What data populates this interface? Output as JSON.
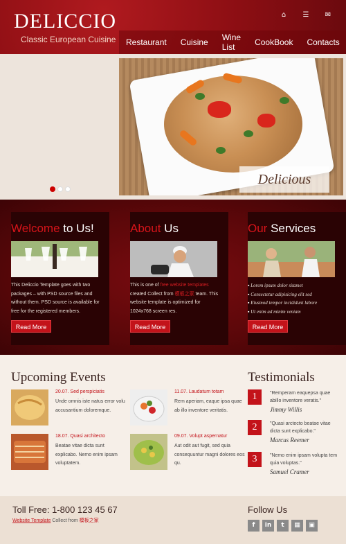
{
  "header": {
    "logo": "DELICCIO",
    "tagline": "Classic European Cuisine",
    "icons": [
      "home-icon",
      "sitemap-icon",
      "mail-icon"
    ],
    "nav": [
      "Restaurant",
      "Cuisine",
      "Wine List",
      "CookBook",
      "Contacts"
    ]
  },
  "hero": {
    "caption": "Delicious",
    "slides": 3,
    "active_slide": 1
  },
  "panels": [
    {
      "title_accent": "Welcome",
      "title_rest": " to Us!",
      "text": "This Deliccio Template goes with two packages – with PSD source files and without them. PSD source is available for free for the registered members.",
      "button": "Read More"
    },
    {
      "title_accent": "About",
      "title_rest": " Us",
      "text_pre": "This is one of ",
      "text_link": "free website templates",
      "text_mid": " created Collect from ",
      "text_link2": "模板之家",
      "text_post": " team. This website template is optimized for 1024x768 screen res.",
      "button": "Read More"
    },
    {
      "title_accent": "Our",
      "title_rest": " Services",
      "list": [
        "Lorem ipsum dolor sitamet",
        "Consectetur adipisicing elit sed",
        "Eiusmod tempor incididunt labore",
        "Ut enim ad minim veniam"
      ],
      "button": "Read More"
    }
  ],
  "events": {
    "heading": "Upcoming Events",
    "items": [
      {
        "date": "20.07. Sed perspiciatis",
        "text": "Unde omnis iste natus error volu accusantium doloremque."
      },
      {
        "date": "11.07. Laudatum totam",
        "text": "Rem aperiam, eaque ipsa quae ab illo inventore veritatis."
      },
      {
        "date": "18.07. Quasi architecto",
        "text": "Beatae vitae dicta sunt explicabo. Nemo enim ipsam voluptatem."
      },
      {
        "date": "09.07. Volupt aspernatur",
        "text": "Aut odit aut fugit, sed quia consequuntur magni dolores eos qu."
      }
    ]
  },
  "testimonials": {
    "heading": "Testimonials",
    "items": [
      {
        "num": "1",
        "text": "\"Remperam eaquepsa quae abillo inventore veratis.\"",
        "author": "Jimmy Willis"
      },
      {
        "num": "2",
        "text": "\"Quasi arctecto beatae vitae dicta sunt explicabo.\"",
        "author": "Marcus Reemer"
      },
      {
        "num": "3",
        "text": "\"Nemo enim ipsam volupta tem quia voluptas.\"",
        "author": "Samuel Cramer"
      }
    ]
  },
  "footer": {
    "tollfree": "Toll Free: 1-800 123 45 67",
    "copy_link": "Website Template",
    "copy_mid": " Collect from ",
    "copy_link2": "模板之家",
    "follow": "Follow Us",
    "social": [
      "f",
      "in",
      "t",
      "▦",
      "▣"
    ]
  },
  "colors": {
    "brand_red": "#c3131a",
    "header_bg": "#8c0e13",
    "band_bg": "#5a0709",
    "panel_bg": "#2a0304"
  }
}
